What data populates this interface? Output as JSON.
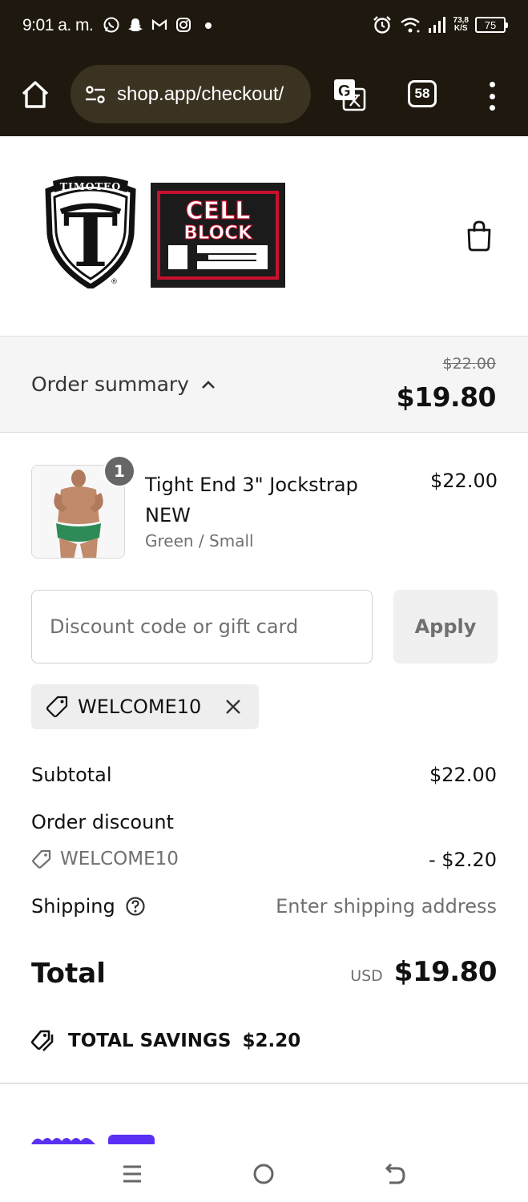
{
  "status_bar": {
    "time": "9:01 a. m.",
    "net_speed_value": "73,8",
    "net_speed_unit": "K/S",
    "battery": "75"
  },
  "browser": {
    "url": "shop.app/checkout/",
    "tab_count": "58"
  },
  "header": {
    "brand_logo_left": "TIMOTEO",
    "brand_logo_right": "CELL BLOCK 13"
  },
  "summary": {
    "toggle_label": "Order summary",
    "compare_price": "$22.00",
    "total": "$19.80"
  },
  "line_item": {
    "quantity": "1",
    "name": "Tight End 3\" Jockstrap NEW",
    "variant": "Green / Small",
    "price": "$22.00"
  },
  "discount": {
    "placeholder": "Discount code or gift card",
    "apply_label": "Apply",
    "applied_code": "WELCOME10"
  },
  "totals": {
    "subtotal_label": "Subtotal",
    "subtotal_value": "$22.00",
    "order_discount_label": "Order discount",
    "discount_code": "WELCOME10",
    "discount_value": "- $2.20",
    "shipping_label": "Shipping",
    "shipping_value": "Enter shipping address",
    "total_label": "Total",
    "currency": "USD",
    "total_value": "$19.80",
    "savings_label": "TOTAL SAVINGS",
    "savings_value": "$2.20"
  },
  "colors": {
    "browser_chrome": "#1e180e",
    "summary_bg": "#f5f5f5",
    "muted_text": "#707070",
    "shop_pay_purple": "#5a31f4"
  }
}
